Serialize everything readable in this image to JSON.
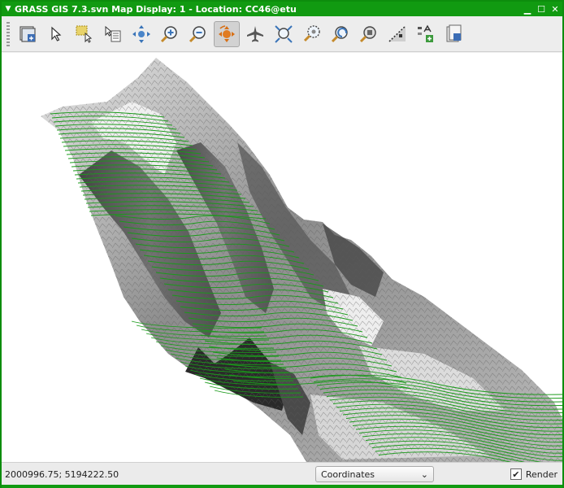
{
  "window": {
    "title": "GRASS GIS 7.3.svn Map Display: 1 - Location: CC46@etu",
    "accent_color": "#119a11"
  },
  "toolbar": {
    "tools": [
      {
        "icon": "display-map-icon"
      },
      {
        "icon": "pointer-icon"
      },
      {
        "icon": "query-icon"
      },
      {
        "icon": "select-icon"
      },
      {
        "icon": "pan-icon"
      },
      {
        "icon": "zoom-in-icon"
      },
      {
        "icon": "zoom-out-icon"
      },
      {
        "icon": "rotate-icon",
        "active": true
      },
      {
        "icon": "flythrough-icon"
      },
      {
        "icon": "zoom-extent-icon"
      },
      {
        "icon": "zoom-region-icon"
      },
      {
        "icon": "zoom-back-icon"
      },
      {
        "icon": "zoom-computational-icon"
      },
      {
        "icon": "analyze-icon"
      },
      {
        "icon": "overlay-icon"
      },
      {
        "icon": "save-display-icon"
      }
    ]
  },
  "status": {
    "coordinates": "2000996.75; 5194222.50",
    "mode_selected": "Coordinates",
    "render_label": "Render",
    "render_checked": true
  },
  "map": {
    "contour_color": "#1a9a1a"
  }
}
